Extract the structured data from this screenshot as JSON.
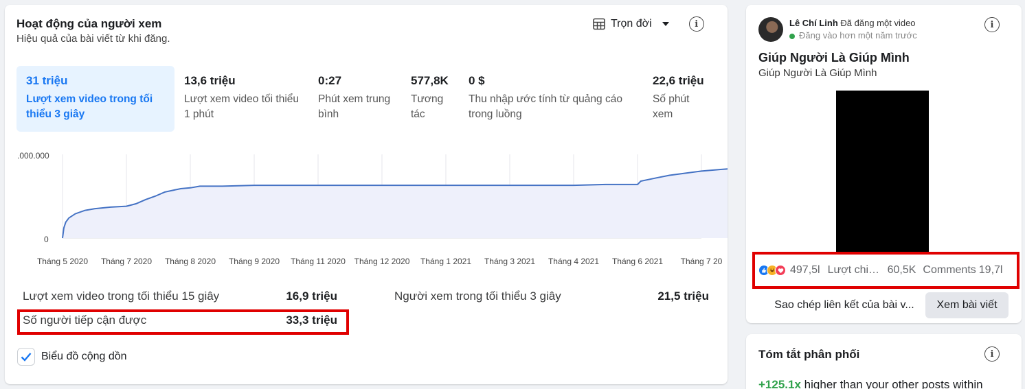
{
  "activity": {
    "title": "Hoạt động của người xem",
    "subtitle": "Hiệu quả của bài viết từ khi đăng.",
    "period_label": "Trọn đời",
    "metrics": [
      {
        "value": "31 triệu",
        "label": "Lượt xem video trong tối thiểu 3 giây",
        "active": true
      },
      {
        "value": "13,6 triệu",
        "label": "Lượt xem video tối thiểu 1 phút"
      },
      {
        "value": "0:27",
        "label": "Phút xem trung bình"
      },
      {
        "value": "577,8K",
        "label": "Tương tác"
      },
      {
        "value": "0 $",
        "label": "Thu nhập ước tính từ quảng cáo trong luồng"
      },
      {
        "value": "22,6 triệu",
        "label": "Số phút xem"
      }
    ],
    "stats": [
      {
        "label": "Lượt xem video trong tối thiểu 15 giây",
        "value": "16,9 triệu"
      },
      {
        "label": "Người xem trong tối thiểu 3 giây",
        "value": "21,5 triệu"
      },
      {
        "label": "Số người tiếp cận được",
        "value": "33,3 triệu"
      }
    ],
    "checkbox_label": "Biểu đồ cộng dồn",
    "checkbox_checked": true
  },
  "chart_data": {
    "type": "area",
    "y_tick_labels": [
      ".000.000",
      "0"
    ],
    "x_tick_labels": [
      "Tháng 5 2020",
      "Tháng 7 2020",
      "Tháng 8 2020",
      "Tháng 9 2020",
      "Tháng 11 2020",
      "Tháng 12 2020",
      "Tháng 1 2021",
      "Tháng 3 2021",
      "Tháng 4 2021",
      "Tháng 6 2021",
      "Tháng 7 20"
    ],
    "line_color": "#4472c4",
    "fill_color": "#eef0fb",
    "series": [
      {
        "points": [
          [
            0,
            0
          ],
          [
            0.02,
            0.12
          ],
          [
            0.05,
            0.19
          ],
          [
            0.1,
            0.24
          ],
          [
            0.2,
            0.29
          ],
          [
            0.35,
            0.33
          ],
          [
            0.5,
            0.35
          ],
          [
            0.75,
            0.37
          ],
          [
            1.0,
            0.38
          ],
          [
            1.15,
            0.41
          ],
          [
            1.3,
            0.46
          ],
          [
            1.45,
            0.5
          ],
          [
            1.6,
            0.55
          ],
          [
            1.85,
            0.59
          ],
          [
            2.0,
            0.6
          ],
          [
            2.15,
            0.62
          ],
          [
            2.5,
            0.62
          ],
          [
            3.0,
            0.63
          ],
          [
            4.0,
            0.63
          ],
          [
            5.0,
            0.63
          ],
          [
            6.0,
            0.63
          ],
          [
            7.0,
            0.63
          ],
          [
            8.0,
            0.63
          ],
          [
            8.5,
            0.64
          ],
          [
            9.0,
            0.64
          ],
          [
            9.05,
            0.68
          ],
          [
            9.3,
            0.72
          ],
          [
            9.5,
            0.75
          ],
          [
            10.0,
            0.8
          ],
          [
            10.3,
            0.82
          ],
          [
            10.5,
            0.83
          ],
          [
            10.7,
            0.84
          ],
          [
            10.8,
            0.85
          ],
          [
            10.9,
            0.86
          ],
          [
            11.0,
            0.87
          ],
          [
            11.2,
            0.88
          ],
          [
            11.4,
            0.89
          ],
          [
            11.6,
            0.9
          ],
          [
            11.8,
            0.91
          ],
          [
            11.95,
            0.92
          ]
        ]
      }
    ],
    "grid": true
  },
  "post": {
    "author": "Lê Chí Linh",
    "action": "Đã đăng một video",
    "time": "Đăng vào hơn một năm trước",
    "title": "Giúp Người Là Giúp Mình",
    "description": "Giúp Người Là Giúp Mình",
    "reactions_count": "497,5l",
    "shares_label": "Lượt chia...",
    "shares_count": "60,5K",
    "comments_label": "Comments",
    "comments_count": "19,7l",
    "copy_link_label": "Sao chép liên kết của bài v...",
    "view_post_label": "Xem bài viết"
  },
  "distribution": {
    "title": "Tóm tắt phân phối",
    "highlight": "+125.1x",
    "text": "higher than your other posts within"
  }
}
